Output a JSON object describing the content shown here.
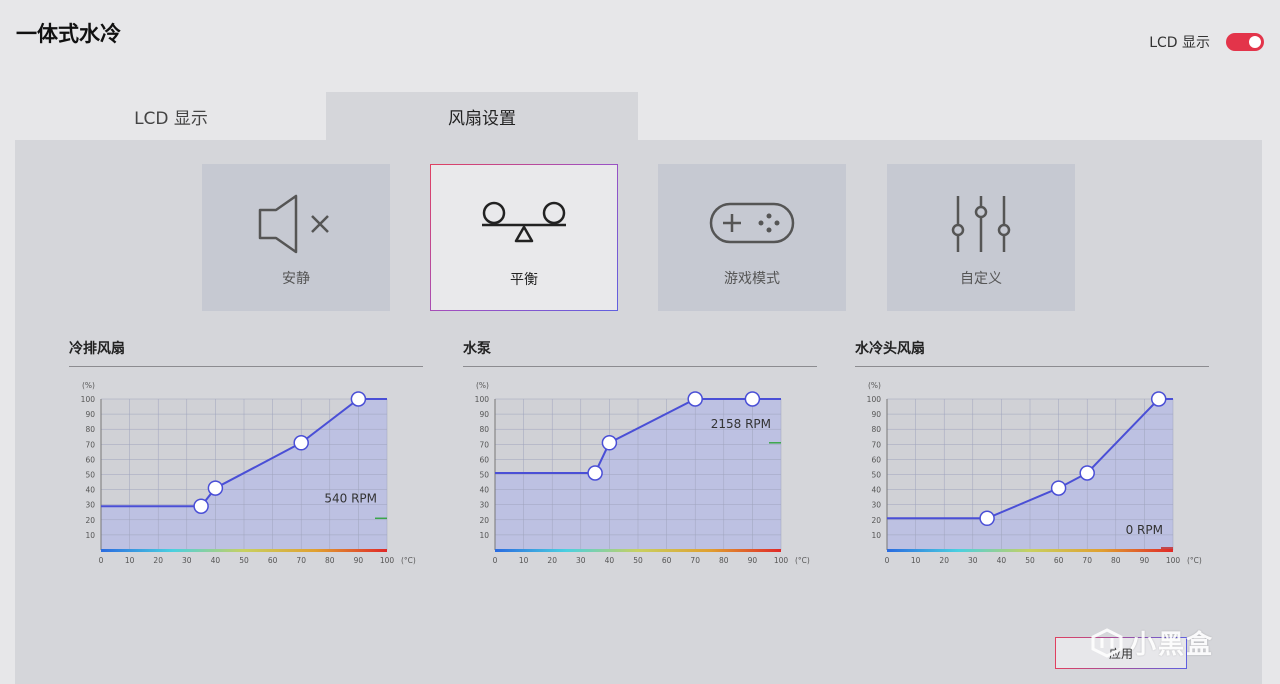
{
  "app": {
    "title": "一体式水冷"
  },
  "header": {
    "lcd_toggle_label": "LCD 显示",
    "lcd_toggle_on": true
  },
  "tabs": [
    {
      "label": "LCD 显示",
      "active": false
    },
    {
      "label": "风扇设置",
      "active": true
    }
  ],
  "modes": [
    {
      "label": "安静",
      "icon": "speaker-mute-icon",
      "active": false
    },
    {
      "label": "平衡",
      "icon": "seesaw-balance-icon",
      "active": true
    },
    {
      "label": "游戏模式",
      "icon": "gamepad-icon",
      "active": false
    },
    {
      "label": "自定义",
      "icon": "sliders-icon",
      "active": false
    }
  ],
  "apply_label": "应用",
  "watermark": "小黑盒",
  "colors": {
    "accent": "#e3344a",
    "curve": "#4a4fd6",
    "fill": "#b7bbe6",
    "rpm_marker": "#3aa64a"
  },
  "chart_data": [
    {
      "type": "line",
      "title": "冷排风扇",
      "xlabel": "(°C)",
      "ylabel": "(%)",
      "xlim": [
        0,
        100
      ],
      "ylim": [
        0,
        100
      ],
      "x_ticks": [
        0,
        10,
        20,
        30,
        40,
        50,
        60,
        70,
        80,
        90,
        100
      ],
      "y_ticks": [
        10,
        20,
        30,
        40,
        50,
        60,
        70,
        80,
        90,
        100
      ],
      "points": [
        [
          0,
          29
        ],
        [
          35,
          29
        ],
        [
          40,
          41
        ],
        [
          70,
          71
        ],
        [
          90,
          100
        ],
        [
          100,
          100
        ]
      ],
      "handles": [
        [
          35,
          29
        ],
        [
          40,
          41
        ],
        [
          70,
          71
        ],
        [
          90,
          100
        ]
      ],
      "rpm_label": "540 RPM",
      "rpm_level": 21
    },
    {
      "type": "line",
      "title": "水泵",
      "xlabel": "(°C)",
      "ylabel": "(%)",
      "xlim": [
        0,
        100
      ],
      "ylim": [
        0,
        100
      ],
      "x_ticks": [
        0,
        10,
        20,
        30,
        40,
        50,
        60,
        70,
        80,
        90,
        100
      ],
      "y_ticks": [
        10,
        20,
        30,
        40,
        50,
        60,
        70,
        80,
        90,
        100
      ],
      "points": [
        [
          0,
          51
        ],
        [
          35,
          51
        ],
        [
          40,
          71
        ],
        [
          70,
          100
        ],
        [
          90,
          100
        ],
        [
          100,
          100
        ]
      ],
      "handles": [
        [
          35,
          51
        ],
        [
          40,
          71
        ],
        [
          70,
          100
        ],
        [
          90,
          100
        ]
      ],
      "rpm_label": "2158 RPM",
      "rpm_level": 71
    },
    {
      "type": "line",
      "title": "水冷头风扇",
      "xlabel": "(°C)",
      "ylabel": "(%)",
      "xlim": [
        0,
        100
      ],
      "ylim": [
        0,
        100
      ],
      "x_ticks": [
        0,
        10,
        20,
        30,
        40,
        50,
        60,
        70,
        80,
        90,
        100
      ],
      "y_ticks": [
        10,
        20,
        30,
        40,
        50,
        60,
        70,
        80,
        90,
        100
      ],
      "points": [
        [
          0,
          21
        ],
        [
          35,
          21
        ],
        [
          60,
          41
        ],
        [
          70,
          51
        ],
        [
          95,
          100
        ],
        [
          100,
          100
        ]
      ],
      "handles": [
        [
          35,
          21
        ],
        [
          60,
          41
        ],
        [
          70,
          51
        ],
        [
          95,
          100
        ]
      ],
      "rpm_label": "0 RPM",
      "rpm_level": 0
    }
  ]
}
